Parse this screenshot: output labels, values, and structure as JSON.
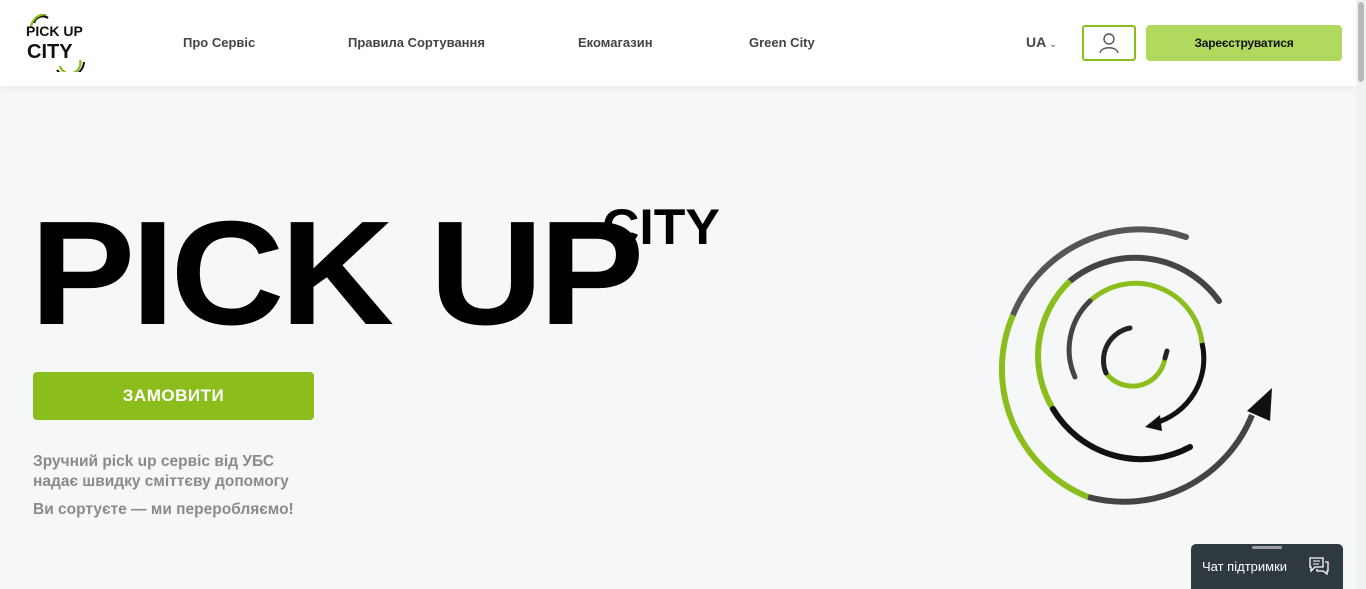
{
  "header": {
    "logo_text_top": "PICK UP",
    "logo_text_bottom": "CITY",
    "nav": [
      "Про Сервіс",
      "Правила Сортування",
      "Екомагазин",
      "Green City"
    ],
    "lang": "UA",
    "register_label": "Зареєструватися"
  },
  "hero": {
    "title_main": "PICK UP",
    "title_sup": "CITY",
    "order_label": "ЗАМОВИТИ",
    "description_line1": "Зручний pick up сервіс від УБС",
    "description_line2": "надає швидку сміттєву допомогу",
    "tagline": "Ви сортуєте — ми переробляємо!"
  },
  "chat": {
    "label": "Чат підтримки"
  },
  "colors": {
    "accent": "#8bbd1d",
    "accent_light": "#b1d95d",
    "text_gray": "#8a8a8a",
    "chat_bg": "#2f3a40"
  }
}
